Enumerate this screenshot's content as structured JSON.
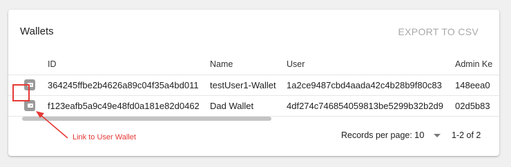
{
  "card": {
    "title": "Wallets",
    "export_label": "EXPORT TO CSV"
  },
  "table": {
    "columns": [
      "ID",
      "Name",
      "User",
      "Admin Ke"
    ],
    "rows": [
      {
        "id": "364245ffbe2b4626a89c04f35a4bd011",
        "name": "testUser1-Wallet",
        "user": "1a2ce9487cbd4aada42c4b28b9f80c83",
        "admin": "148eea0"
      },
      {
        "id": "f123eafb5a9c49e48fd0a181e82d0462",
        "name": "Dad Wallet",
        "user": "4df274c74685405981 3be5299b32b2d9",
        "admin": "02d5b83"
      }
    ]
  },
  "pagination": {
    "rows_per_page_label": "Records per page:",
    "rows_per_page_value": "10",
    "range": "1-2 of 2"
  },
  "annotation": {
    "text": "Link to User Wallet",
    "color": "#e53935"
  },
  "icons": {
    "row_action": "wallet-icon"
  }
}
